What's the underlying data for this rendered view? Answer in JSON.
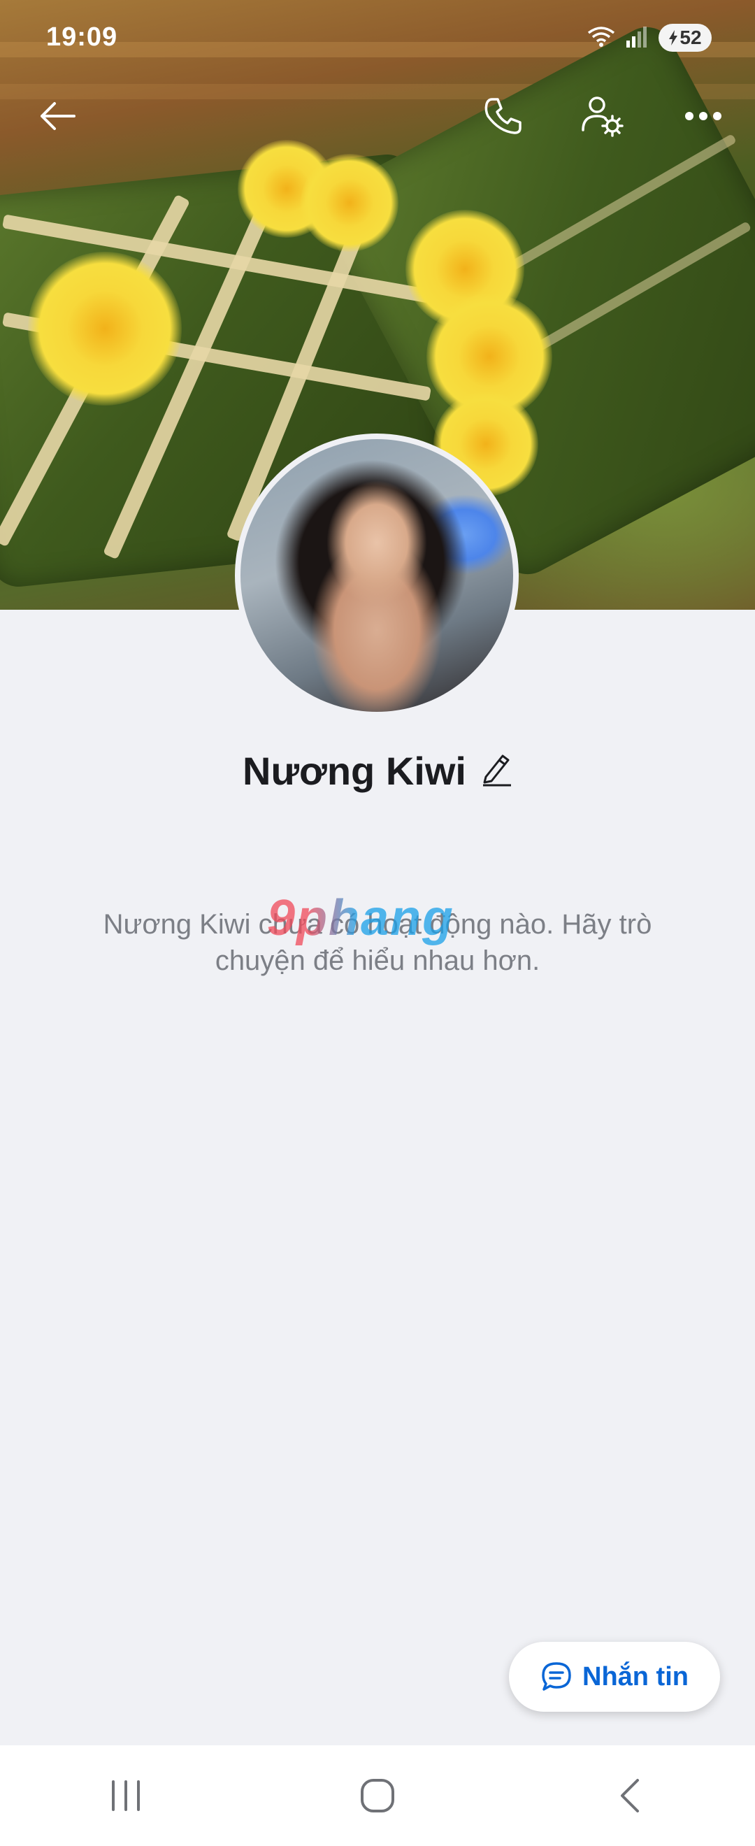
{
  "status_bar": {
    "time": "19:09",
    "battery": "52",
    "icons": [
      "wifi-icon",
      "signal-icon",
      "battery-icon"
    ]
  },
  "top_bar": {
    "back_icon": "arrow-left-icon",
    "actions": [
      "phone-icon",
      "user-settings-icon",
      "more-icon"
    ]
  },
  "profile": {
    "name": "Nương Kiwi",
    "edit_icon": "pencil-icon",
    "empty_message": "Nương Kiwi chưa có hoạt động nào. Hãy trò chuyện để hiểu nhau hơn."
  },
  "watermark": "9phang",
  "chat_button": {
    "label": "Nhắn tin",
    "icon": "chat-bubble-icon"
  },
  "nav_bar": {
    "items": [
      "recent-apps-icon",
      "home-icon",
      "back-icon"
    ]
  },
  "colors": {
    "accent": "#0a66d6",
    "background": "#f0f1f5",
    "text_primary": "#1b1c20",
    "text_secondary": "#7c7f86"
  }
}
